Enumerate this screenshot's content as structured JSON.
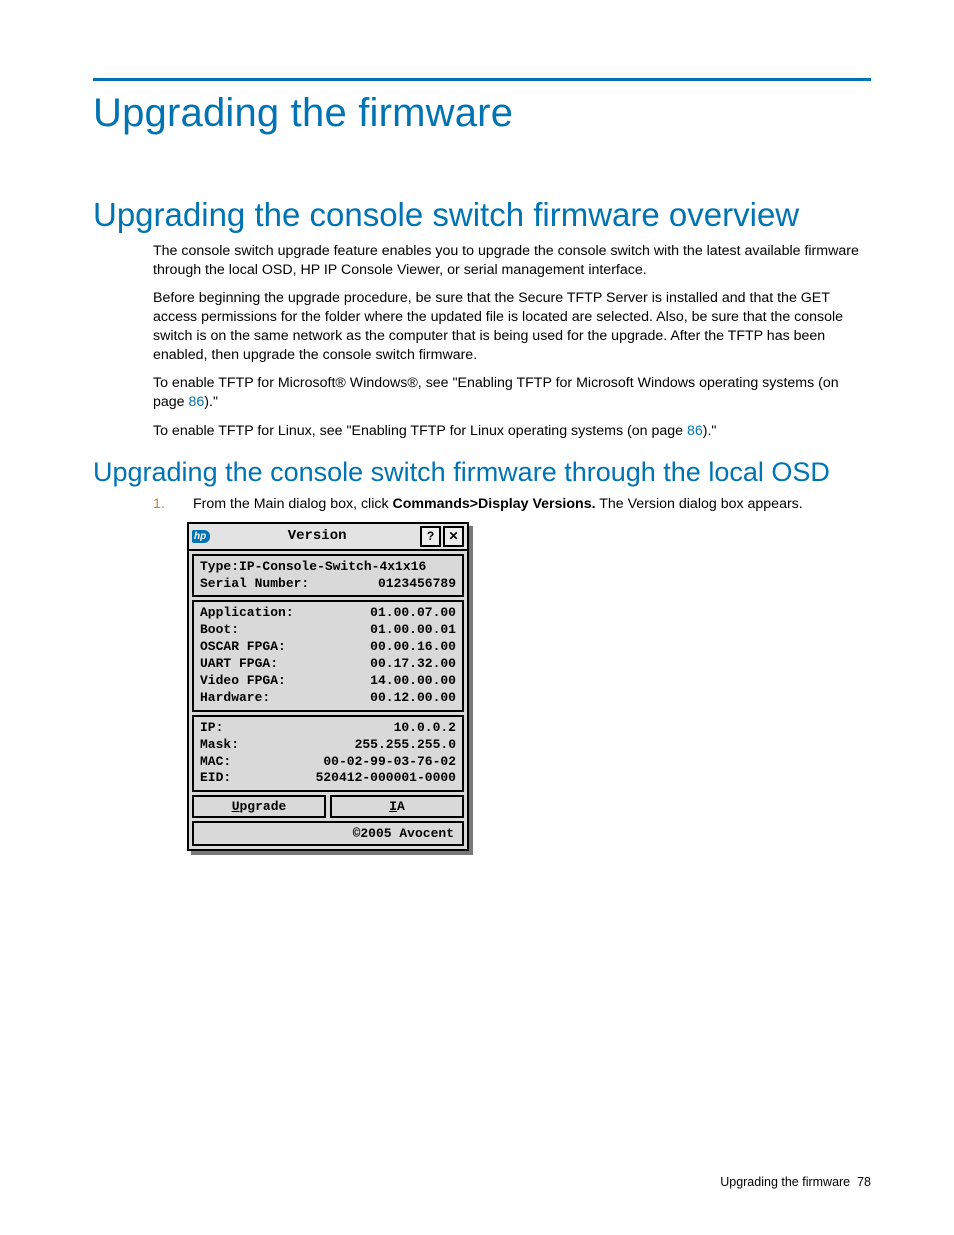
{
  "h1": "Upgrading the firmware",
  "h2": "Upgrading the console switch firmware overview",
  "p1": "The console switch upgrade feature enables you to upgrade the console switch with the latest available firmware through the local OSD, HP IP Console Viewer, or serial management interface.",
  "p2": "Before beginning the upgrade procedure, be sure that the Secure TFTP Server is installed and that the GET access permissions for the folder where the updated file is located are selected. Also, be sure that the console switch is on the same network as the computer that is being used for the upgrade. After the TFTP has been enabled, then upgrade the console switch firmware.",
  "p3_a": "To enable TFTP for Microsoft® Windows®, see \"Enabling TFTP for Microsoft Windows operating systems (on page ",
  "p3_link": "86",
  "p3_b": ").\"",
  "p4_a": "To enable TFTP for Linux, see \"Enabling TFTP for Linux operating systems (on page ",
  "p4_link": "86",
  "p4_b": ").\"",
  "h3": "Upgrading the console switch firmware through the local OSD",
  "step1_num": "1.",
  "step1_a": "From the Main dialog box, click ",
  "step1_bold": "Commands>Display Versions.",
  "step1_b": " The Version dialog box appears.",
  "osd": {
    "title": "Version",
    "type_label": "Type:",
    "type_value": "IP-Console-Switch-4x1x16",
    "serial_label": "Serial Number:",
    "serial_value": "0123456789",
    "rows1": [
      {
        "k": "Application:",
        "v": "01.00.07.00"
      },
      {
        "k": "Boot:",
        "v": "01.00.00.01"
      },
      {
        "k": "OSCAR FPGA:",
        "v": "00.00.16.00"
      },
      {
        "k": "UART FPGA:",
        "v": "00.17.32.00"
      },
      {
        "k": "Video FPGA:",
        "v": "14.00.00.00"
      },
      {
        "k": "Hardware:",
        "v": "00.12.00.00"
      }
    ],
    "rows2": [
      {
        "k": "IP:",
        "v": "10.0.0.2"
      },
      {
        "k": "Mask:",
        "v": "255.255.255.0"
      },
      {
        "k": "MAC:",
        "v": "00-02-99-03-76-02"
      },
      {
        "k": "EID:",
        "v": "520412-000001-0000"
      }
    ],
    "btn_upgrade_u": "U",
    "btn_upgrade_rest": "pgrade",
    "btn_ia_u": "I",
    "btn_ia_rest": "A",
    "footer": "©2005 Avocent",
    "help": "?",
    "close": "✕",
    "logo": "hp"
  },
  "footer_text": "Upgrading the firmware",
  "footer_page": "78"
}
